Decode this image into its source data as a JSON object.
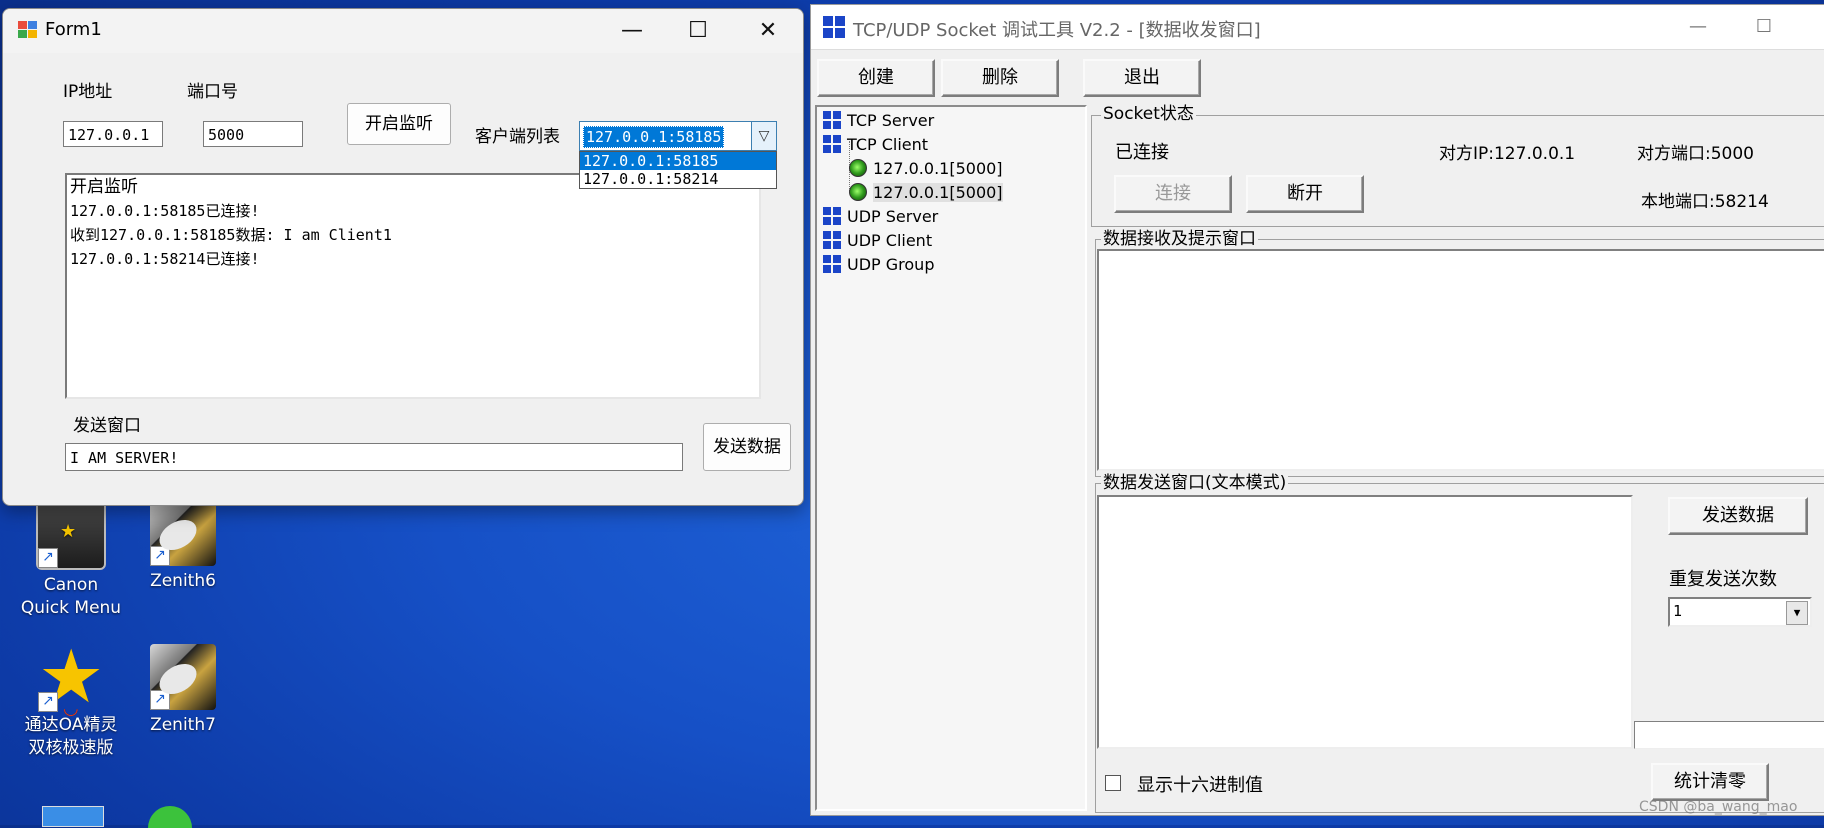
{
  "desktop": {
    "icons": [
      {
        "label1": "Canon",
        "label2": "Quick Menu",
        "icon": "canon-quick-menu-icon"
      },
      {
        "label1": "Zenith6",
        "label2": "",
        "icon": "zenith-icon"
      },
      {
        "label1": "通达OA精灵",
        "label2": "双核极速版",
        "icon": "tongda-oa-star-icon"
      },
      {
        "label1": "Zenith7",
        "label2": "",
        "icon": "zenith-icon"
      }
    ]
  },
  "form1": {
    "title": "Form1",
    "ip_label": "IP地址",
    "port_label": "端口号",
    "ip_value": "127.0.0.1",
    "port_value": "5000",
    "listen_button": "开启监听",
    "client_list_label": "客户端列表",
    "client_selected": "127.0.0.1:58185",
    "client_options": [
      "127.0.0.1:58185",
      "127.0.0.1:58214"
    ],
    "log_lines": [
      "开启监听",
      "127.0.0.1:58185已连接!",
      "收到127.0.0.1:58185数据: I am Client1",
      "127.0.0.1:58214已连接!"
    ],
    "send_label": "发送窗口",
    "send_value": "I AM SERVER!",
    "send_button": "发送数据",
    "min_glyph": "—",
    "max_glyph": "☐",
    "close_glyph": "✕"
  },
  "socket_tool": {
    "title": "TCP/UDP Socket 调试工具 V2.2 - [数据收发窗口]",
    "toolbar": {
      "create": "创建",
      "delete": "删除",
      "exit": "退出"
    },
    "tree": {
      "tcp_server": "TCP Server",
      "tcp_client": "TCP Client",
      "client1": "127.0.0.1[5000]",
      "client2": "127.0.0.1[5000]",
      "udp_server": "UDP Server",
      "udp_client": "UDP Client",
      "udp_group": "UDP Group"
    },
    "socket_status": {
      "title": "Socket状态",
      "state": "已连接",
      "remote_ip": "对方IP:127.0.0.1",
      "remote_port": "对方端口:5000",
      "local_port": "本地端口:58214",
      "connect_button": "连接",
      "disconnect_button": "断开"
    },
    "recv_title": "数据接收及提示窗口",
    "send_title": "数据发送窗口(文本模式)",
    "send_button": "发送数据",
    "repeat_label": "重复发送次数",
    "repeat_value": "1",
    "hex_label": "显示十六进制值",
    "reset_button": "统计清零",
    "watermark": "CSDN @ba_wang_mao"
  },
  "colors": {
    "desktop_blue": "#1650c6",
    "selection_blue": "#0078d7"
  }
}
